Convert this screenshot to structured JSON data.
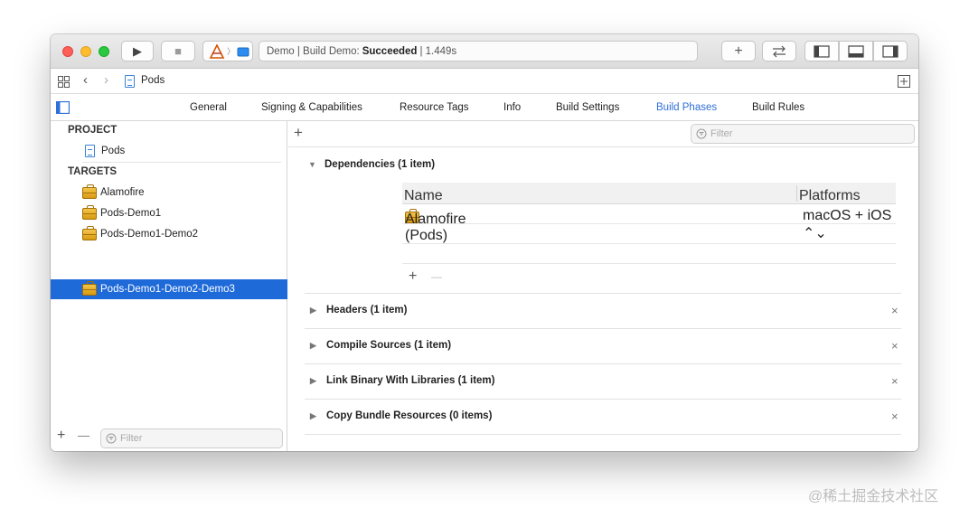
{
  "toolbar": {
    "scheme": "Demo",
    "activity_prefix": "Demo | Build Demo:",
    "activity_status": "Succeeded",
    "activity_suffix": "| 1.449s",
    "add_glyph": "+",
    "play_glyph": "▶",
    "stop_glyph": "■"
  },
  "jumpbar": {
    "breadcrumb": "Pods"
  },
  "tabs": [
    "General",
    "Signing & Capabilities",
    "Resource Tags",
    "Info",
    "Build Settings",
    "Build Phases",
    "Build Rules"
  ],
  "active_tab": "Build Phases",
  "sidebar": {
    "project_header": "PROJECT",
    "project_item": "Pods",
    "targets_header": "TARGETS",
    "targets": [
      "Alamofire",
      "Pods-Demo1",
      "Pods-Demo1-Demo2",
      "Pods-Demo1-Demo2-Demo3"
    ],
    "selected_target": "Pods-Demo1-Demo2-Demo3",
    "filter_placeholder": "Filter",
    "add_glyph": "+",
    "remove_glyph": "—"
  },
  "main": {
    "filter_placeholder": "Filter",
    "add_glyph": "+",
    "dependencies": {
      "title": "Dependencies (1 item)",
      "col_name": "Name",
      "col_platforms": "Platforms",
      "rows": [
        {
          "name": "Alamofire (Pods)",
          "platforms": "macOS + iOS ⌃⌄"
        }
      ],
      "add_glyph": "+",
      "remove_glyph": "—"
    },
    "phases": [
      {
        "title": "Headers (1 item)"
      },
      {
        "title": "Compile Sources (1 item)"
      },
      {
        "title": "Link Binary With Libraries (1 item)"
      },
      {
        "title": "Copy Bundle Resources (0 items)"
      }
    ],
    "close_glyph": "×"
  },
  "watermark": "@稀土掘金技术社区",
  "colors": {
    "accent": "#1f6ad9",
    "active_tab": "#2e6fd8",
    "close": "#fe5f57",
    "minimize": "#febc2e",
    "zoom": "#28c840"
  }
}
